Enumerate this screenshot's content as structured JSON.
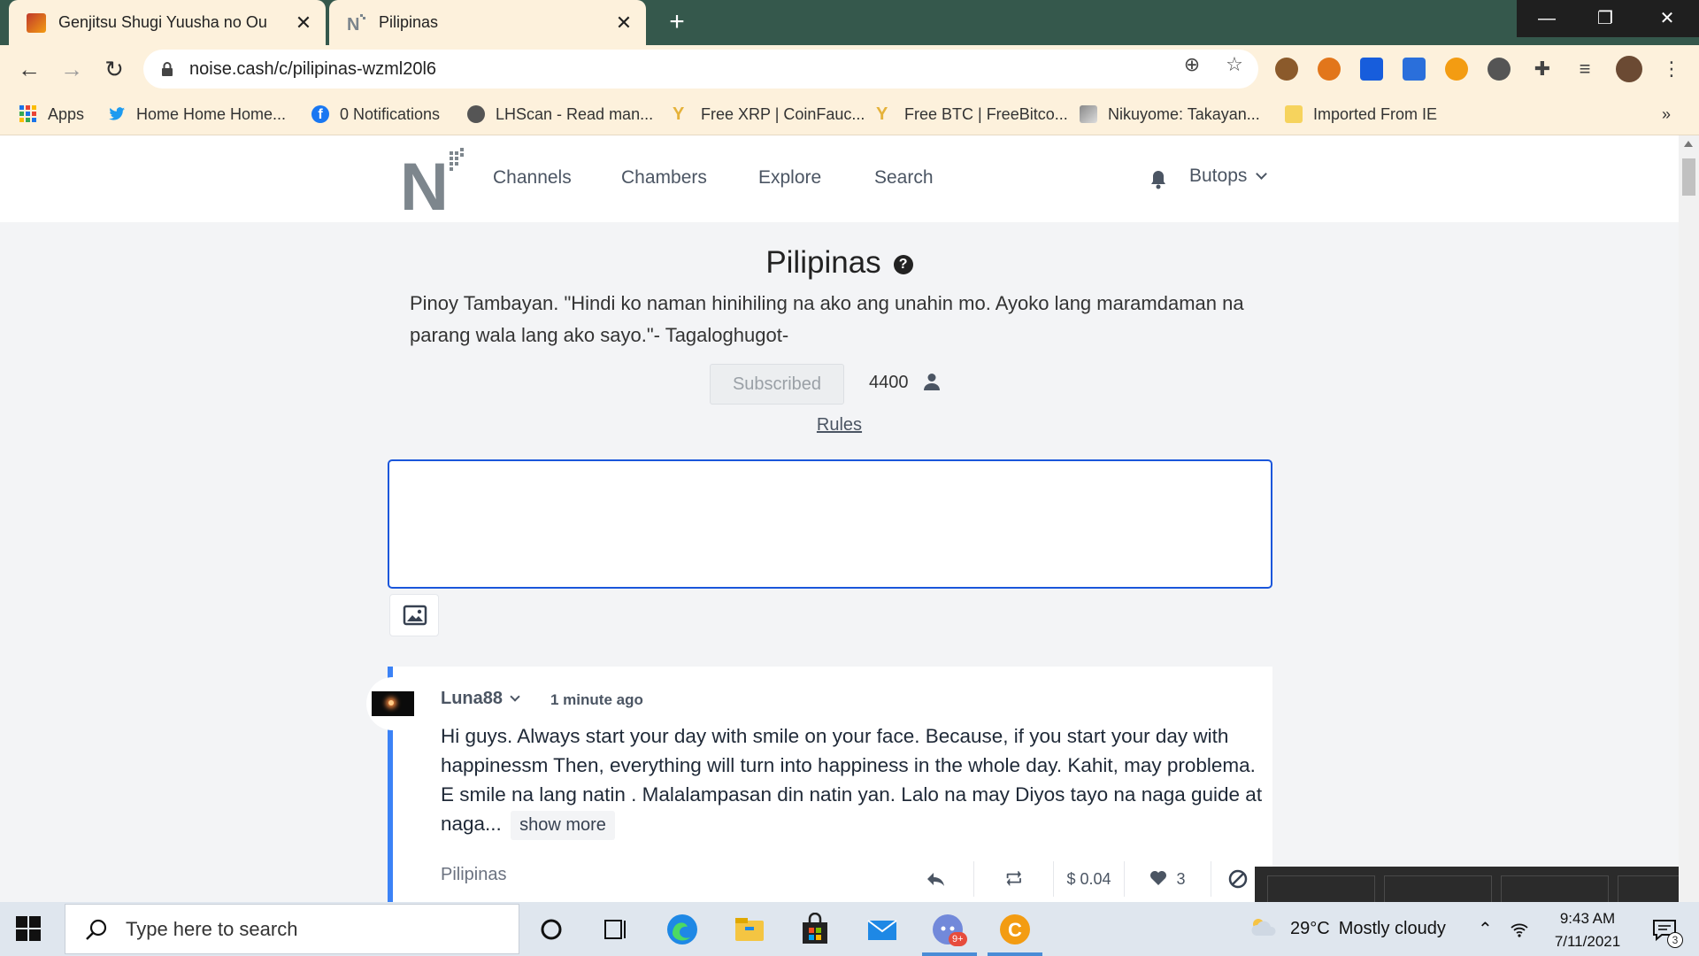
{
  "browser": {
    "tabs": [
      {
        "title": "Genjitsu Shugi Yuusha no Ou",
        "active": false
      },
      {
        "title": "Pilipinas",
        "active": true
      }
    ],
    "new_tab_label": "+",
    "url": "noise.cash/c/pilipinas-wzml20l6",
    "bookmarks": [
      {
        "label": "Apps",
        "icon": "apps-grid-icon"
      },
      {
        "label": "Home Home Home...",
        "icon": "twitter-icon"
      },
      {
        "label": "0 Notifications",
        "icon": "facebook-icon"
      },
      {
        "label": "LHScan - Read man...",
        "icon": "globe-icon"
      },
      {
        "label": "Free XRP | CoinFauc...",
        "icon": "faucet-icon"
      },
      {
        "label": "Free BTC | FreeBitco...",
        "icon": "faucet-icon"
      },
      {
        "label": "Nikuyome: Takayan...",
        "icon": "manga-icon"
      },
      {
        "label": "Imported From IE",
        "icon": "folder-icon"
      }
    ],
    "more_bookmarks": "»"
  },
  "site": {
    "nav": [
      "Channels",
      "Chambers",
      "Explore",
      "Search"
    ],
    "username": "Butops"
  },
  "channel": {
    "title": "Pilipinas",
    "description": "Pinoy Tambayan. \"Hindi ko naman hinihiling na ako ang unahin mo. Ayoko lang maramdaman na parang wala lang ako sayo.\"- Tagaloghugot-",
    "subscribe_label": "Subscribed",
    "subscribers": "4400",
    "rules_label": "Rules"
  },
  "post": {
    "author": "Luna88",
    "time": "1 minute ago",
    "body": "Hi guys. Always start your day with smile on your face. Because, if you start your day with happinessm Then, everything will turn into happiness in the whole day. Kahit, may problema. E smile na lang natin . Malalampasan din natin yan. Lalo na may Diyos tayo na naga guide at naga...",
    "show_more": "show more",
    "channel": "Pilipinas",
    "tip_amount": "$ 0.04",
    "likes": "3"
  },
  "taskbar": {
    "search_placeholder": "Type here to search",
    "weather_temp": "29°C",
    "weather_desc": "Mostly cloudy",
    "time": "9:43 AM",
    "date": "7/11/2021",
    "notification_count": "3",
    "discord_badge": "9+"
  },
  "colors": {
    "tabbar": "#35584c",
    "chrome": "#fdf1dc",
    "accent": "#3b82f6",
    "composer_border": "#1a56db"
  }
}
